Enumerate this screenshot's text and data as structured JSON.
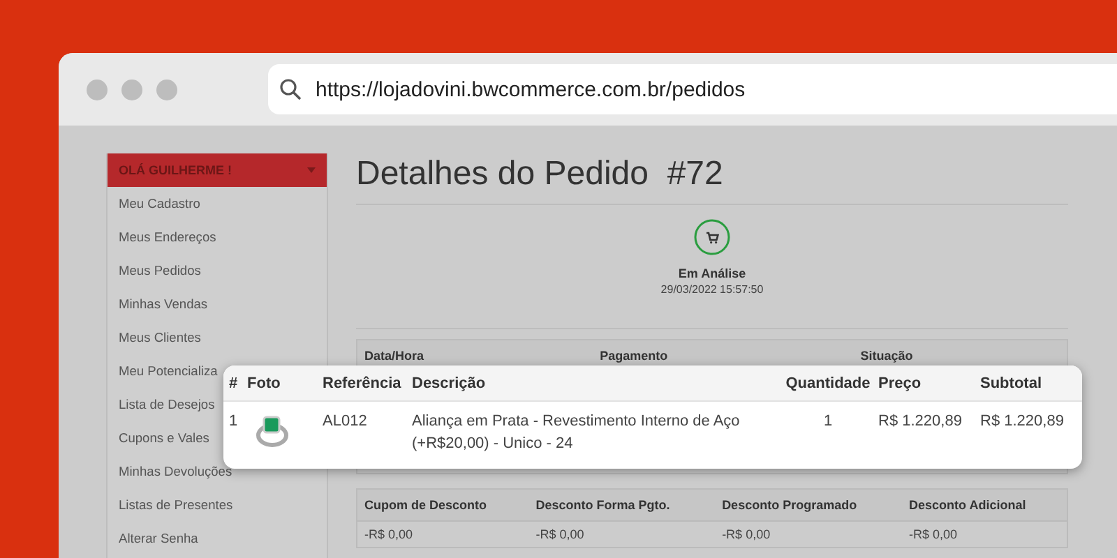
{
  "browser": {
    "url": "https://lojadovini.bwcommerce.com.br/pedidos"
  },
  "sidebar": {
    "title": "OLÁ GUILHERME !",
    "items": [
      {
        "label": "Meu Cadastro"
      },
      {
        "label": "Meus Endereços"
      },
      {
        "label": "Meus Pedidos"
      },
      {
        "label": "Minhas Vendas"
      },
      {
        "label": "Meus Clientes"
      },
      {
        "label": "Meu Potencializa"
      },
      {
        "label": "Lista de Desejos"
      },
      {
        "label": "Cupons e Vales"
      },
      {
        "label": "Minhas Devoluções"
      },
      {
        "label": "Listas de Presentes"
      },
      {
        "label": "Alterar Senha"
      }
    ]
  },
  "page": {
    "title": "Detalhes do Pedido  #72",
    "status": {
      "label": "Em Análise",
      "date": "29/03/2022 15:57:50"
    }
  },
  "order_table": {
    "columns": [
      "Data/Hora",
      "Pagamento",
      "Situação"
    ]
  },
  "discount_table": {
    "columns": [
      "Cupom de Desconto",
      "Desconto Forma Pgto.",
      "Desconto Programado",
      "Desconto Adicional"
    ],
    "values": [
      "-R$ 0,00",
      "-R$ 0,00",
      "-R$ 0,00",
      "-R$ 0,00"
    ]
  },
  "items_table": {
    "columns": [
      "#",
      "Foto",
      "Referência",
      "Descrição",
      "Quantidade",
      "Preço",
      "Subtotal"
    ],
    "rows": [
      {
        "number": "1",
        "reference": "AL012",
        "description": "Aliança em Prata - Revestimento Interno de Aço (+R$20,00) - Unico - 24",
        "quantity": "1",
        "price": "R$ 1.220,89",
        "subtotal": "R$ 1.220,89"
      }
    ]
  }
}
